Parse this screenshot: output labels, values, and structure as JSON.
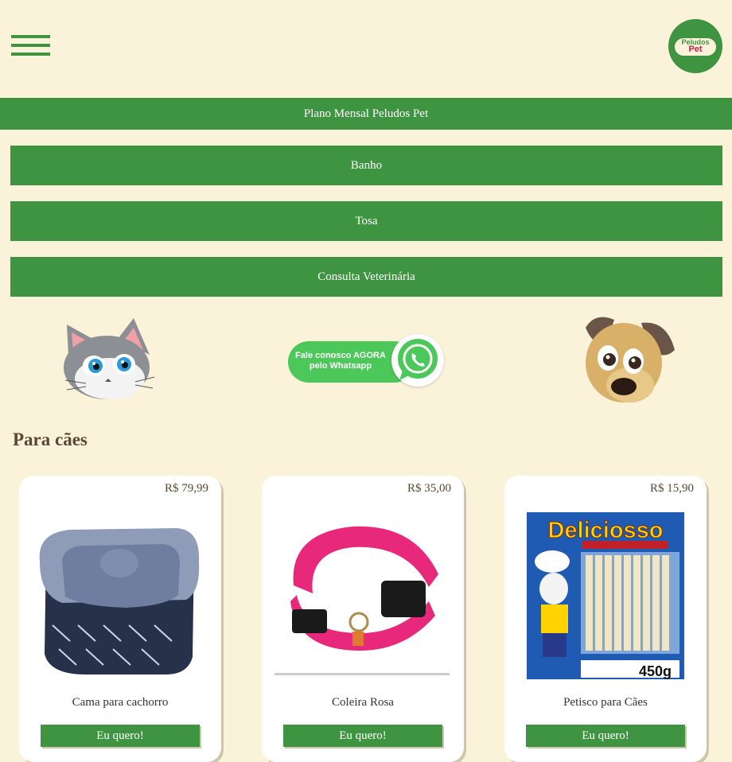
{
  "header": {
    "menu_icon": "hamburger-icon",
    "logo": {
      "icon": "peludos-pet-logo",
      "text_top": "Peludos",
      "text_bottom": "Pet"
    }
  },
  "nav": {
    "plano": "Plano Mensal Peludos Pet",
    "services": [
      "Banho",
      "Tosa",
      "Consulta Veterinária"
    ]
  },
  "banner": {
    "cat_icon": "cat-face-icon",
    "dog_icon": "dog-face-icon",
    "whatsapp": {
      "line1": "Fale conosco AGORA",
      "line2": "pelo Whatsapp",
      "icon": "whatsapp-icon"
    }
  },
  "section": {
    "title": "Para cães"
  },
  "products": [
    {
      "price": "R$ 79,99",
      "name": "Cama para cachorro",
      "button": "Eu quero!"
    },
    {
      "price": "R$ 35,00",
      "name": "Coleira Rosa",
      "button": "Eu quero!"
    },
    {
      "price": "R$ 15,90",
      "name": "Petisco para Cães",
      "button": "Eu quero!",
      "brand": "Deliciosso",
      "weight": "450g"
    }
  ],
  "colors": {
    "background": "#fbf3d9",
    "primary_green": "#3f9442",
    "whatsapp_green": "#4cc85a",
    "heading_brown": "#5a4632"
  }
}
